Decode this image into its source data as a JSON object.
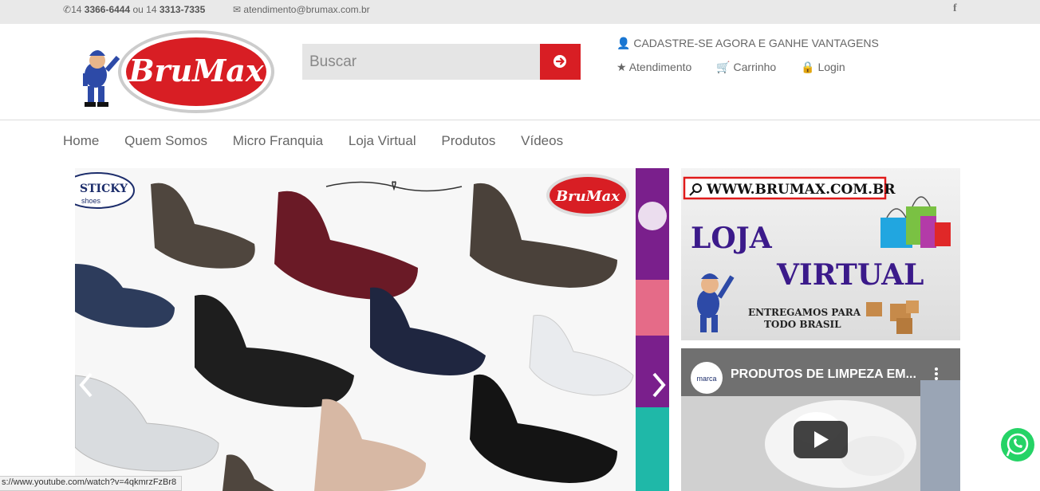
{
  "topbar": {
    "phone_prefix": "14",
    "phone1": "3366-6444",
    "phone_sep": "ou 14",
    "phone2": "3313-7335",
    "email": "atendimento@brumax.com.br",
    "social_icon": "facebook-icon"
  },
  "header": {
    "logo_text": "BruMax",
    "search_placeholder": "Buscar",
    "promo": "CADASTRE-SE AGORA E GANHE VANTAGENS",
    "links": [
      {
        "icon": "star-icon",
        "label": "Atendimento"
      },
      {
        "icon": "cart-icon",
        "label": "Carrinho"
      },
      {
        "icon": "lock-icon",
        "label": "Login"
      }
    ]
  },
  "nav": {
    "items": [
      "Home",
      "Quem Somos",
      "Micro Franquia",
      "Loja Virtual",
      "Produtos",
      "Vídeos"
    ]
  },
  "slider": {
    "brand_left": "STICKY",
    "brand_left_sub": "shoes",
    "brand_right": "BruMax",
    "prev_icon": "chevron-left-icon",
    "next_icon": "chevron-right-icon"
  },
  "side_banner": {
    "url": "WWW.BRUMAX.COM.BR",
    "title_line1": "LOJA",
    "title_line2": "VIRTUAL",
    "delivery_line1": "ENTREGAMOS PARA",
    "delivery_line2": "TODO BRASIL"
  },
  "video": {
    "channel": "marca",
    "title": "PRODUTOS DE LIMPEZA EM...",
    "menu_icon": "more-vert-icon",
    "play_icon": "play-icon"
  },
  "statusbar": {
    "url": "s://www.youtube.com/watch?v=4qkmrzFzBr8"
  },
  "colors": {
    "brand_red": "#d81e24",
    "topbar_bg": "#e9e9e9",
    "banner_purple": "#3b1a8a",
    "whatsapp_green": "#25d366"
  }
}
